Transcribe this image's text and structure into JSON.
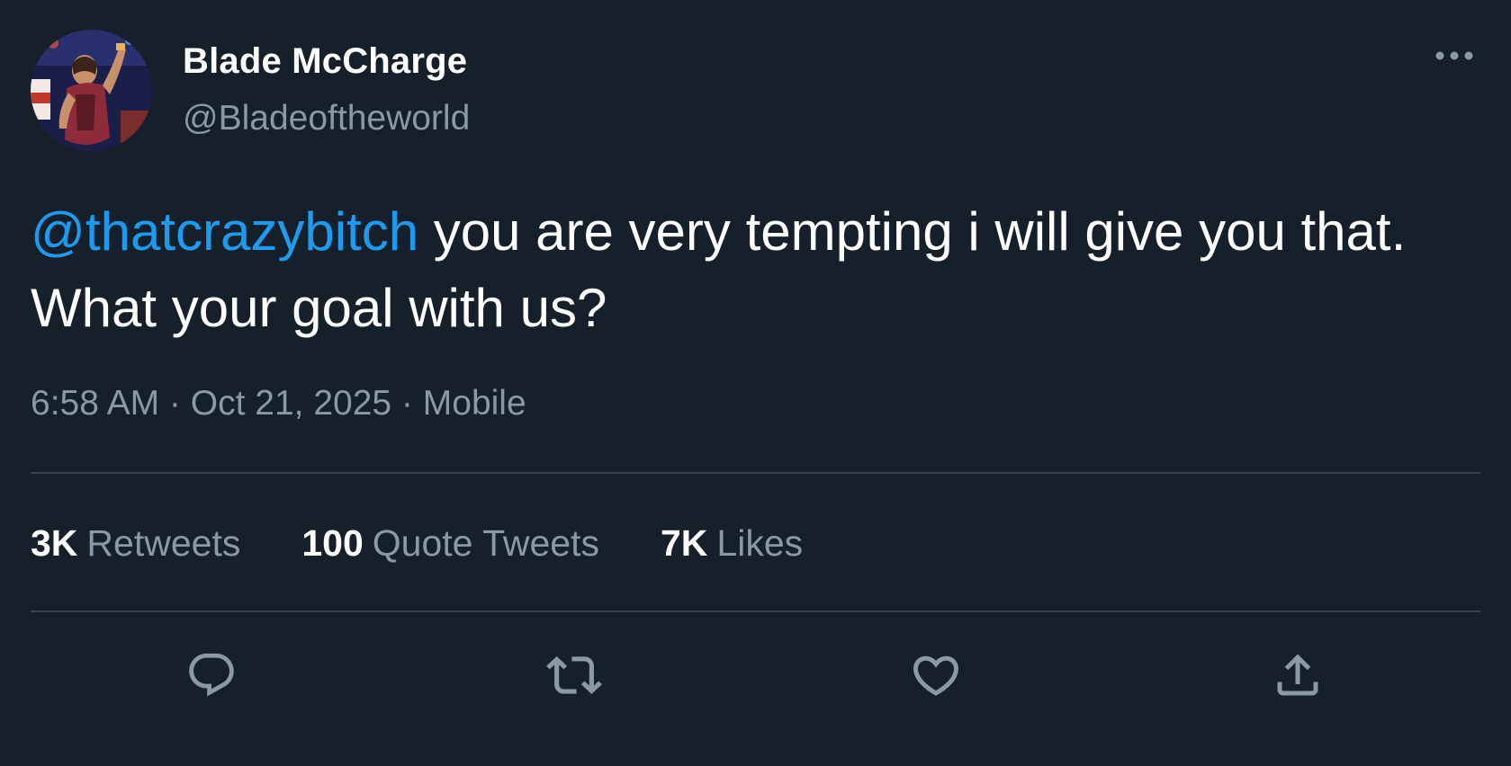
{
  "author": {
    "display_name": "Blade McCharge",
    "handle": "@Bladeoftheworld",
    "avatar_icon": "wrestler-avatar-icon"
  },
  "tweet": {
    "mention": "@thatcrazybitch",
    "text": " you are very tempting i will give you that. What your goal with us?",
    "time": "6:58 AM",
    "separator": " · ",
    "date": "Oct 21, 2025",
    "source": "Mobile"
  },
  "stats": {
    "retweets_count": "3K",
    "retweets_label": "Retweets",
    "quotes_count": "100",
    "quotes_label": "Quote Tweets",
    "likes_count": "7K",
    "likes_label": "Likes"
  },
  "actions": [
    "reply-icon",
    "retweet-icon",
    "like-icon",
    "share-icon"
  ],
  "colors": {
    "background": "#15202b",
    "text": "#ffffff",
    "secondary": "#8b98a5",
    "accent": "#1d9bf0",
    "divider": "#38444d"
  }
}
